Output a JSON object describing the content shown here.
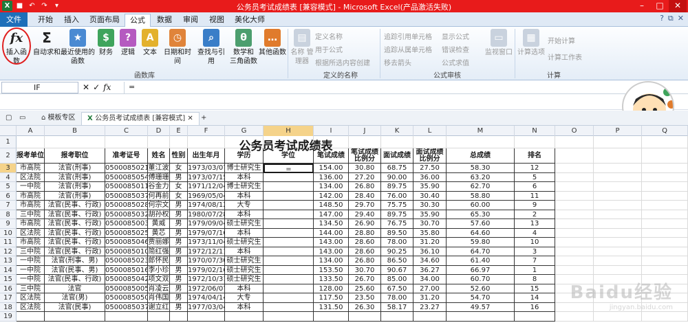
{
  "window": {
    "title": "公务员考试成绩表 [兼容模式] - Microsoft Excel(产品激活失败)"
  },
  "tabs": [
    "文件",
    "开始",
    "插入",
    "页面布局",
    "公式",
    "数据",
    "审阅",
    "视图",
    "美化大师"
  ],
  "ribbon": {
    "function_library": {
      "insert_function": "插入函数",
      "autosum": "自动求和",
      "recent": "最近使用的 函数",
      "financial": "财务",
      "logical": "逻辑",
      "text": "文本",
      "datetime": "日期和时间",
      "lookup": "查找与引用",
      "math": "数学和 三角函数",
      "more": "其他函数",
      "label": "函数库"
    },
    "defined_names": {
      "manager": "名称 管理器",
      "define": "定义名称",
      "use": "用于公式",
      "create": "根据所选内容创建",
      "label": "定义的名称"
    },
    "auditing": {
      "trace_precedents": "追踪引用单元格",
      "trace_dependents": "追踪从属单元格",
      "remove_arrows": "移去箭头",
      "show_formulas": "显示公式",
      "error_check": "错误检查",
      "evaluate": "公式求值",
      "watch": "监视窗口",
      "label": "公式审核"
    },
    "calculation": {
      "options": "计算选项",
      "calc_now": "开始计算",
      "calc_sheet": "计算工作表",
      "label": "计算"
    }
  },
  "formula_bar": {
    "name_box": "IF",
    "formula": "="
  },
  "doc_tabs": [
    "模板专区",
    "公务员考试成绩表 [兼容模式]"
  ],
  "columns": [
    "A",
    "B",
    "C",
    "D",
    "E",
    "F",
    "G",
    "H",
    "I",
    "J",
    "K",
    "L",
    "M",
    "N",
    "O",
    "P",
    "Q"
  ],
  "sheet": {
    "title": "公务员考试成绩表",
    "headers": [
      "报考单位",
      "报考职位",
      "准考证号",
      "姓名",
      "性别",
      "出生年月",
      "学历",
      "学位",
      "笔试成绩",
      "笔试成绩比例分",
      "面试成绩",
      "面试成绩比例分",
      "总成绩",
      "排名"
    ],
    "rows": [
      [
        "市高院",
        "法官(刑事)",
        "050008502132",
        "董江波",
        "女",
        "1973/03/07",
        "博士研究生",
        "=",
        "154.00",
        "30.80",
        "68.75",
        "27.50",
        "58.30",
        "12"
      ],
      [
        "区法院",
        "法官(刑事)",
        "050008505460",
        "傅珊珊",
        "男",
        "1973/07/15",
        "本科",
        "",
        "136.00",
        "27.20",
        "90.00",
        "36.00",
        "63.20",
        "5"
      ],
      [
        "一中院",
        "法官(刑事)",
        "050008501144",
        "谷金力",
        "女",
        "1971/12/04",
        "博士研究生",
        "",
        "134.00",
        "26.80",
        "89.75",
        "35.90",
        "62.70",
        "6"
      ],
      [
        "市高院",
        "法官(刑事)",
        "050008503756",
        "何再前",
        "女",
        "1969/05/04",
        "本科",
        "",
        "142.00",
        "28.40",
        "76.00",
        "30.40",
        "58.80",
        "11"
      ],
      [
        "市高院",
        "法官(民事、行政)",
        "050008502813",
        "何宗文",
        "男",
        "1974/08/12",
        "大专",
        "",
        "148.50",
        "29.70",
        "75.75",
        "30.30",
        "60.00",
        "9"
      ],
      [
        "三中院",
        "法官(民事、行政)",
        "050008503258",
        "胡孙权",
        "男",
        "1980/07/28",
        "本科",
        "",
        "147.00",
        "29.40",
        "89.75",
        "35.90",
        "65.30",
        "2"
      ],
      [
        "市高院",
        "法官(民事、行政)",
        "050008500383",
        "黄威",
        "男",
        "1979/09/04",
        "硕士研究生",
        "",
        "134.50",
        "26.90",
        "76.75",
        "30.70",
        "57.60",
        "13"
      ],
      [
        "区法院",
        "法官(民事、行政)",
        "050008502550",
        "黄芯",
        "男",
        "1979/07/16",
        "本科",
        "",
        "144.00",
        "28.80",
        "89.50",
        "35.80",
        "64.60",
        "4"
      ],
      [
        "市高院",
        "法官(民事、行政)",
        "050008504650",
        "贾丽娜",
        "男",
        "1973/11/04",
        "硕士研究生",
        "",
        "143.00",
        "28.60",
        "78.00",
        "31.20",
        "59.80",
        "10"
      ],
      [
        "三中院",
        "法官(民事、行政)",
        "050008501073",
        "简红强",
        "男",
        "1972/12/11",
        "本科",
        "",
        "143.00",
        "28.60",
        "90.25",
        "36.10",
        "64.70",
        "3"
      ],
      [
        "一中院",
        "法官(刑事、男)",
        "050008502309",
        "郎怀民",
        "男",
        "1970/07/30",
        "硕士研究生",
        "",
        "134.00",
        "26.80",
        "86.50",
        "34.60",
        "61.40",
        "7"
      ],
      [
        "一中院",
        "法官(民事、男)",
        "050008501663",
        "李小珍",
        "男",
        "1979/02/16",
        "硕士研究生",
        "",
        "153.50",
        "30.70",
        "90.67",
        "36.27",
        "66.97",
        "1"
      ],
      [
        "一中院",
        "法官(民事、行政)",
        "050008504259",
        "项文双",
        "男",
        "1972/10/31",
        "硕士研究生",
        "",
        "133.50",
        "26.70",
        "85.00",
        "34.00",
        "60.70",
        "8"
      ],
      [
        "三中院",
        "法官",
        "050008500508",
        "肖凌云",
        "男",
        "1972/06/07",
        "本科",
        "",
        "128.00",
        "25.60",
        "67.50",
        "27.00",
        "52.60",
        "15"
      ],
      [
        "区法院",
        "法官(男)",
        "050008505099",
        "肖伟国",
        "男",
        "1974/04/14",
        "大专",
        "",
        "117.50",
        "23.50",
        "78.00",
        "31.20",
        "54.70",
        "14"
      ],
      [
        "区法院",
        "法官(民事)",
        "050008503790",
        "谢立红",
        "男",
        "1977/03/04",
        "本科",
        "",
        "131.50",
        "26.30",
        "58.17",
        "23.27",
        "49.57",
        "16"
      ]
    ]
  },
  "watermark": {
    "main": "Baidu经验",
    "sub": "jingyan.baidu.com"
  }
}
